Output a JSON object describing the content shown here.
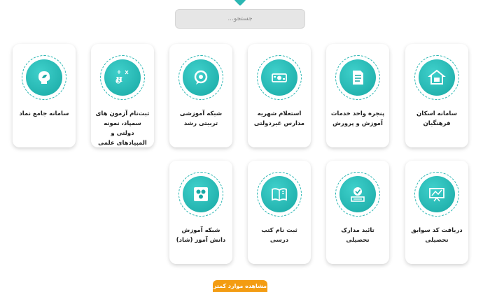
{
  "search": {
    "placeholder": "جستجو..."
  },
  "row1": [
    {
      "label": "سامانه اسکان فرهنگیان",
      "icon": "house-icon"
    },
    {
      "label": "پنجره واحد خدمات آموزش و پرورش",
      "icon": "document-icon"
    },
    {
      "label": "استعلام شهریه مدارس غیردولتی",
      "icon": "money-icon"
    },
    {
      "label": "شبکه آموزشی تربیتی رشد",
      "icon": "location-pin-icon"
    },
    {
      "label": "ثبت‌نام آزمون های سمپاد، نمونه دولتی و المپیادهای علمی",
      "icon": "pi-science-icon"
    },
    {
      "label": "سامانه جامع نماد",
      "icon": "head-leaf-icon"
    }
  ],
  "row2": [
    {
      "label": "دریافت کد سوابق تحصیلی",
      "icon": "presentation-board-icon"
    },
    {
      "label": "تائید مدارک تحصیلی",
      "icon": "approved-certificate-icon"
    },
    {
      "label": "ثبت نام کتب درسی",
      "icon": "open-book-icon"
    },
    {
      "label": "شبکه آموزش دانش آموز (شاد)",
      "icon": "shad-logo-icon"
    }
  ],
  "more_button": "مشاهده موارد کمتر"
}
